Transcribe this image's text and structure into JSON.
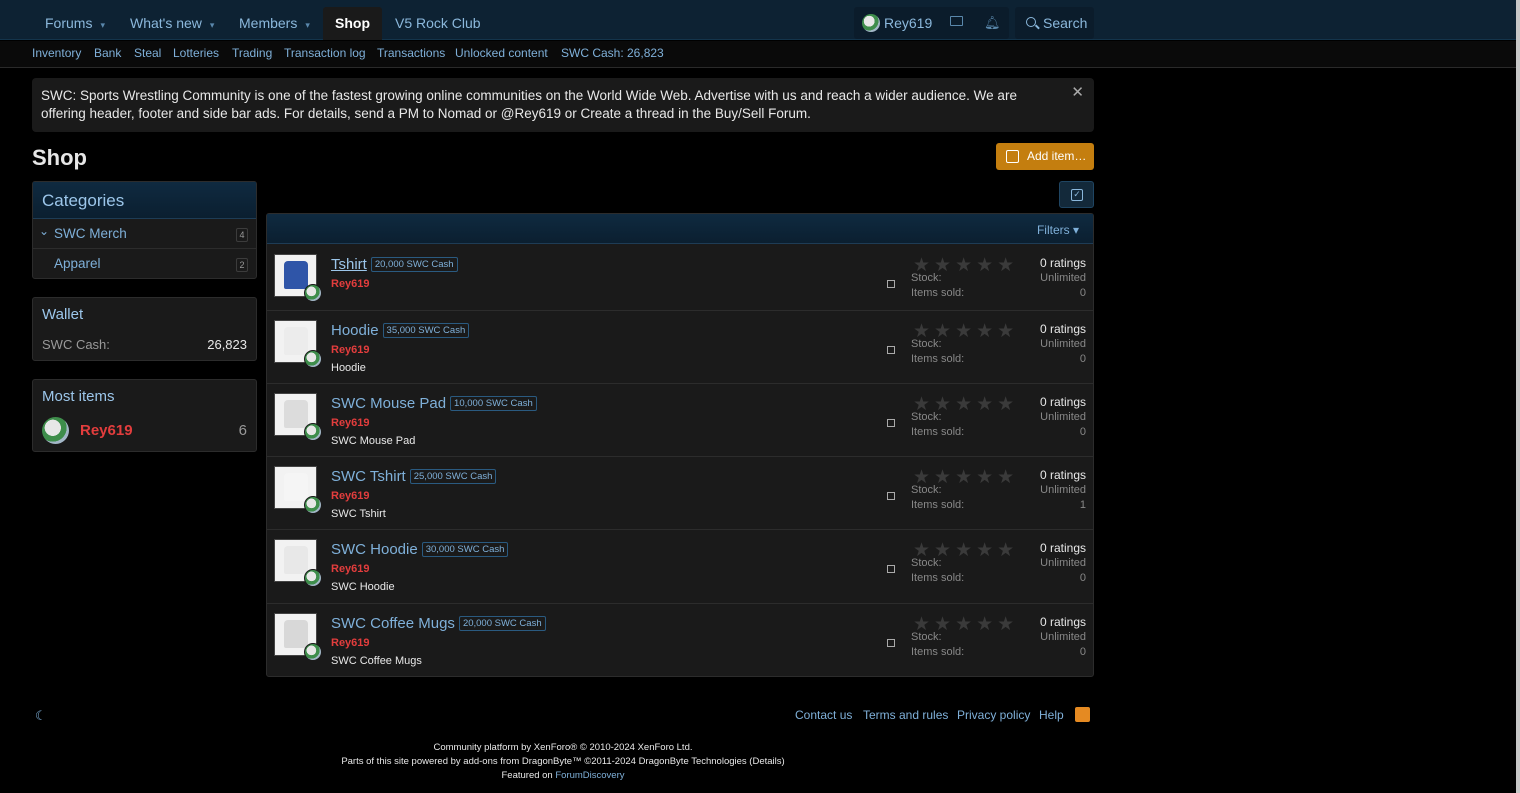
{
  "topnav": {
    "tabs": [
      {
        "label": "Forums",
        "caret": "▾"
      },
      {
        "label": "What's new",
        "caret": "▾"
      },
      {
        "label": "Members",
        "caret": "▾"
      },
      {
        "label": "Shop",
        "caret": ""
      },
      {
        "label": "V5 Rock Club",
        "caret": ""
      }
    ],
    "username": "Rey619",
    "search_label": "Search"
  },
  "subnav": [
    "Inventory",
    "Bank",
    "Steal",
    "Lotteries",
    "Trading",
    "Transaction log",
    "Transactions",
    "Unlocked content",
    "SWC Cash: 26,823"
  ],
  "notice": {
    "text": "SWC: Sports Wrestling Community is one of the fastest growing online communities on the World Wide Web. Advertise with us and reach a wider audience. We are offering header, footer and side bar ads. For details, send a PM to Nomad or @Rey619 or Create a thread in the Buy/Sell Forum.",
    "close": "✕"
  },
  "page_title": "Shop",
  "add_item_label": "Add item…",
  "sidebar": {
    "categories_title": "Categories",
    "categories": [
      {
        "label": "SWC Merch",
        "count": "4",
        "expand": "⌄"
      },
      {
        "label": "Apparel",
        "count": "2"
      }
    ],
    "wallet_title": "Wallet",
    "wallet_label": "SWC Cash:",
    "wallet_value": "26,823",
    "most_items_title": "Most items",
    "most_items_user": "Rey619",
    "most_items_count": "6"
  },
  "list": {
    "filters_label": "Filters ▾",
    "stock_label": "Stock:",
    "sold_label": "Items sold:",
    "items": [
      {
        "title": "Tshirt",
        "price": "20,000 SWC Cash",
        "seller": "Rey619",
        "desc": "",
        "ratings": "0 ratings",
        "stock": "Unlimited",
        "sold": "0",
        "color": "#2f55a8"
      },
      {
        "title": "Hoodie",
        "price": "35,000 SWC Cash",
        "seller": "Rey619",
        "desc": "Hoodie",
        "ratings": "0 ratings",
        "stock": "Unlimited",
        "sold": "0",
        "color": "#ececec"
      },
      {
        "title": "SWC Mouse Pad",
        "price": "10,000 SWC Cash",
        "seller": "Rey619",
        "desc": "SWC Mouse Pad",
        "ratings": "0 ratings",
        "stock": "Unlimited",
        "sold": "0",
        "color": "#dcdcdc"
      },
      {
        "title": "SWC Tshirt",
        "price": "25,000 SWC Cash",
        "seller": "Rey619",
        "desc": "SWC Tshirt",
        "ratings": "0 ratings",
        "stock": "Unlimited",
        "sold": "1",
        "color": "#f5f5f5"
      },
      {
        "title": "SWC Hoodie",
        "price": "30,000 SWC Cash",
        "seller": "Rey619",
        "desc": "SWC Hoodie",
        "ratings": "0 ratings",
        "stock": "Unlimited",
        "sold": "0",
        "color": "#e8e8e8"
      },
      {
        "title": "SWC Coffee Mugs",
        "price": "20,000 SWC Cash",
        "seller": "Rey619",
        "desc": "SWC Coffee Mugs",
        "ratings": "0 ratings",
        "stock": "Unlimited",
        "sold": "0",
        "color": "#d8d8d8"
      }
    ]
  },
  "footer": {
    "links": [
      "Contact us",
      "Terms and rules",
      "Privacy policy",
      "Help"
    ],
    "line1": "Community platform by XenForo® © 2010-2024 XenForo Ltd.",
    "line2": "Parts of this site powered by add-ons from DragonByte™ ©2011-2024 DragonByte Technologies (Details)",
    "line3_prefix": "Featured on",
    "line3_link": "ForumDiscovery"
  }
}
